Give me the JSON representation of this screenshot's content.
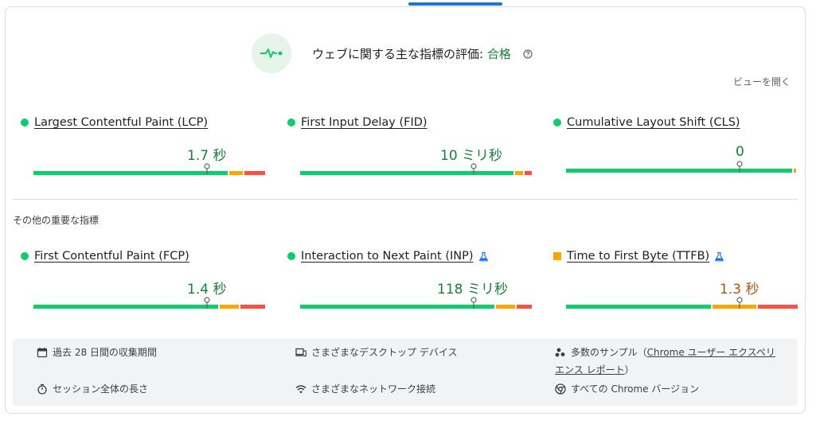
{
  "header": {
    "title": "ウェブに関する主な指標の評価: ",
    "status": "合格"
  },
  "expand_label": "ビューを開く",
  "core_metrics": [
    {
      "name": "Largest Contentful Paint (LCP)",
      "value": "1.7 秒",
      "rating": "good"
    },
    {
      "name": "First Input Delay (FID)",
      "value": "10 ミリ秒",
      "rating": "good"
    },
    {
      "name": "Cumulative Layout Shift (CLS)",
      "value": "0",
      "rating": "good"
    }
  ],
  "other_label": "その他の重要な指標",
  "other_metrics": [
    {
      "name": "First Contentful Paint (FCP)",
      "value": "1.4 秒",
      "rating": "good"
    },
    {
      "name": "Interaction to Next Paint (INP)",
      "value": "118 ミリ秒",
      "rating": "good"
    },
    {
      "name": "Time to First Byte (TTFB)",
      "value": "1.3 秒",
      "rating": "average"
    }
  ],
  "info": {
    "collection_period": "過去 28 日間の収集期間",
    "devices": "さまざまなデスクトップ デバイス",
    "samples_prefix": "多数のサンプル（",
    "samples_link_1": "Chrome ユーザー エクスペリ",
    "samples_link_2": "エンス レポート",
    "samples_suffix": "）",
    "session": "セッション全体の長さ",
    "networks": "さまざまなネットワーク接続",
    "chrome_versions": "すべての Chrome バージョン"
  },
  "colors": {
    "good": "#0cce6b",
    "average": "#ffa400",
    "poor": "#ff4e42",
    "accent": "#1a73e8"
  }
}
